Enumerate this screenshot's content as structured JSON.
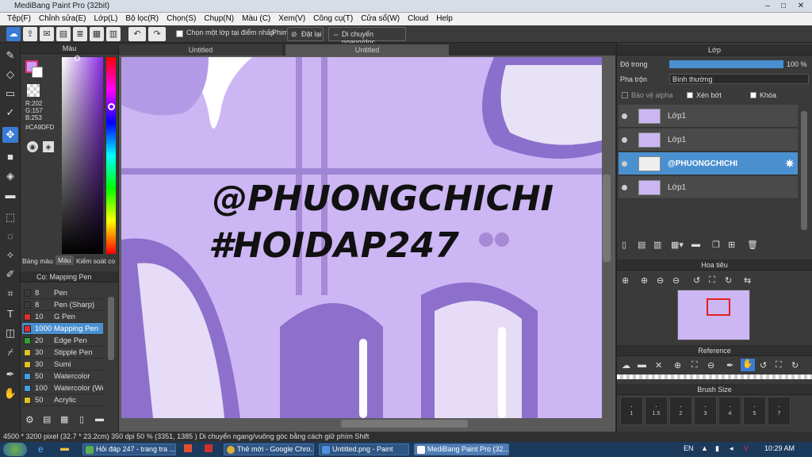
{
  "window": {
    "title": "MediBang Paint Pro (32bit)"
  },
  "menu": [
    "Tệp(F)",
    "Chỉnh sửa(E)",
    "Lớp(L)",
    "Bộ lọc(R)",
    "Chọn(S)",
    "Chụp(N)",
    "Màu (C)",
    "Xem(V)",
    "Công cụ(T)",
    "Cửa sổ(W)",
    "Cloud",
    "Help"
  ],
  "toolbar": {
    "checkbox_label": "Chọn một lớp tại điểm nhấp",
    "phim_label": "Phim",
    "reset_label": "Đặt lại",
    "move_label": "Di chuyển ngang/dọc"
  },
  "colorpanel": {
    "title": "Màu",
    "r": "R:202",
    "g": "G:157",
    "b": "B:253",
    "hex": "#CA9DFD",
    "tabs": [
      "Bảng màu",
      "Màu",
      "Kiểm soát co"
    ],
    "fg": "#ca9dfd"
  },
  "brushpanel": {
    "title": "Cọ: Mapping Pen",
    "items": [
      {
        "size": "8",
        "name": "Pen",
        "color": "#3a3a3a"
      },
      {
        "size": "8",
        "name": "Pen (Sharp)",
        "color": "#3a3a3a"
      },
      {
        "size": "10",
        "name": "G Pen",
        "color": "#d83030"
      },
      {
        "size": "1000",
        "name": "Mapping Pen",
        "color": "#d83030",
        "sel": true
      },
      {
        "size": "20",
        "name": "Edge Pen",
        "color": "#30a030"
      },
      {
        "size": "30",
        "name": "Stipple Pen",
        "color": "#e0c020"
      },
      {
        "size": "30",
        "name": "Sumi",
        "color": "#e0c020"
      },
      {
        "size": "50",
        "name": "Watercolor",
        "color": "#40a0e0"
      },
      {
        "size": "100",
        "name": "Watercolor (Wet)",
        "color": "#40a0e0"
      },
      {
        "size": "50",
        "name": "Acrylic",
        "color": "#e0c020"
      }
    ]
  },
  "doctabs": [
    "Untitled",
    "Untitled"
  ],
  "canvas": {
    "line1": "@PHUONGCHICHI",
    "line2": "#HOIDAP247"
  },
  "layers": {
    "title": "Lớp",
    "opacity_label": "Độ trong",
    "opacity_value": "100 %",
    "blend_label": "Pha trộn",
    "blend_value": "Bình thường",
    "protect_alpha": "Bảo vệ alpha",
    "clipping": "Xén bớt",
    "lock": "Khóa",
    "items": [
      {
        "name": "Lớp1"
      },
      {
        "name": "Lớp1"
      },
      {
        "name": "@PHUONGCHICHI",
        "sel": true
      },
      {
        "name": "Lớp1"
      }
    ]
  },
  "navigator": {
    "title": "Hoa tiêu"
  },
  "reference": {
    "title": "Reference"
  },
  "brushsize": {
    "title": "Brush Size",
    "sizes": [
      "1",
      "1.5",
      "2",
      "3",
      "4",
      "5",
      "7"
    ]
  },
  "status": {
    "text": "4500 * 3200 pixel  (32.7 * 23.2cm)  350 dpi  50 %  (3351, 1385 )  Di chuyển ngang/vuông góc bằng cách giữ phím Shift"
  },
  "taskbar": {
    "items": [
      "Hỏi đáp 247 - trang tra ...",
      "Thẻ mới - Google Chro...",
      "Untitled.png - Paint",
      "MediBang Paint Pro (32..."
    ],
    "lang": "EN",
    "time": "10:29 AM"
  },
  "colors": {
    "accent": "#4a90d0",
    "canvas": "#cdb6f4"
  }
}
